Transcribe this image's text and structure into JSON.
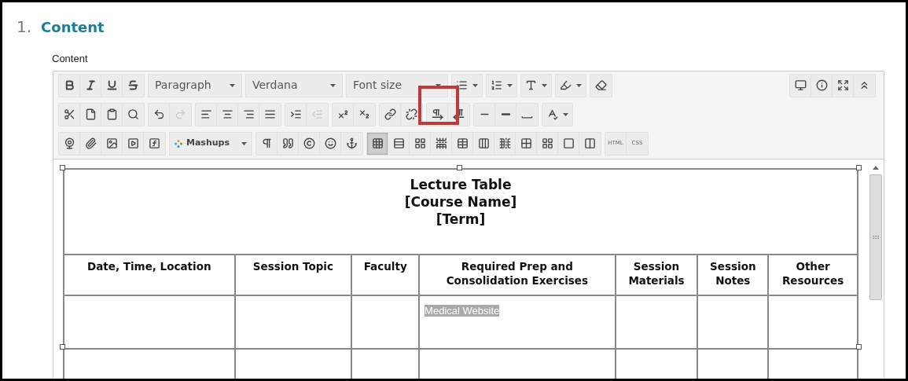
{
  "section": {
    "number": "1.",
    "title": "Content"
  },
  "field_label": "Content",
  "toolbar": {
    "paragraph_format": "Paragraph",
    "font_family": "Verdana",
    "font_size": "Font size",
    "mashups": "Mashups",
    "html": "HTML",
    "css": "CSS",
    "redo": {
      "disabled": true
    },
    "outdent": {
      "disabled": true
    },
    "table_grid": {
      "selected": true
    }
  },
  "table": {
    "title_lines": [
      "Lecture Table",
      "[Course Name]",
      "[Term]"
    ],
    "columns": [
      "Date, Time, Location",
      "Session Topic",
      "Faculty",
      "Required Prep and Consolidation Exercises",
      "Session Materials",
      "Session Notes",
      "Other Resources"
    ],
    "rows": [
      [
        null,
        null,
        null,
        {
          "text": "Medical Website",
          "selected": true
        },
        null,
        null,
        null
      ],
      [
        null,
        null,
        null,
        null,
        null,
        null,
        null
      ]
    ]
  }
}
